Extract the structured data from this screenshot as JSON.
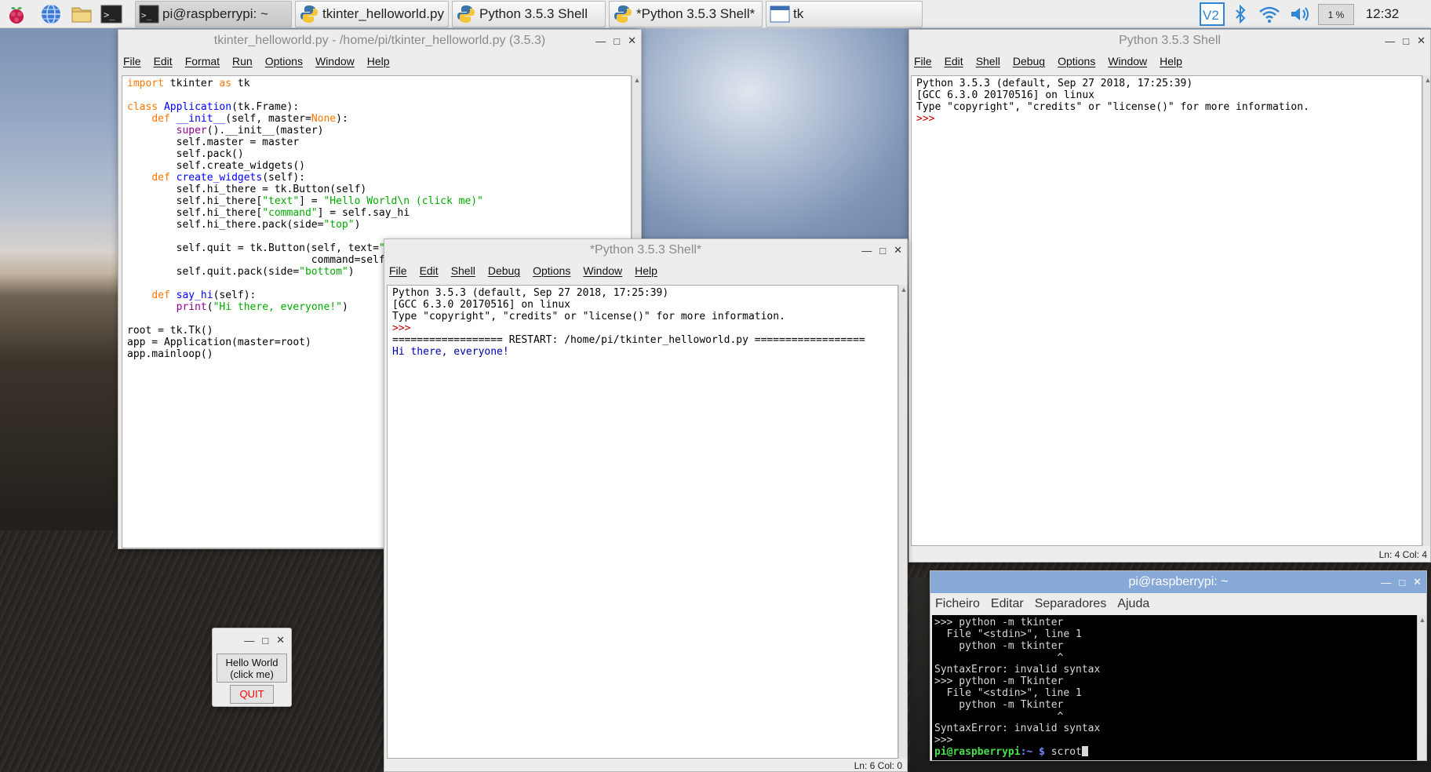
{
  "taskbar": {
    "tasks": [
      {
        "label": "pi@raspberrypi: ~"
      },
      {
        "label": "tkinter_helloworld.py ..."
      },
      {
        "label": "Python 3.5.3 Shell"
      },
      {
        "label": "*Python 3.5.3 Shell*"
      },
      {
        "label": "tk"
      }
    ],
    "cpu_label": "1 %",
    "clock": "12:32"
  },
  "editor_window": {
    "title": "tkinter_helloworld.py - /home/pi/tkinter_helloworld.py (3.5.3)",
    "menu": [
      "File",
      "Edit",
      "Format",
      "Run",
      "Options",
      "Window",
      "Help"
    ]
  },
  "shell_right": {
    "title": "Python 3.5.3 Shell",
    "menu": [
      "File",
      "Edit",
      "Shell",
      "Debug",
      "Options",
      "Window",
      "Help"
    ],
    "lines": [
      "Python 3.5.3 (default, Sep 27 2018, 17:25:39)",
      "[GCC 6.3.0 20170516] on linux",
      "Type \"copyright\", \"credits\" or \"license()\" for more information."
    ],
    "prompt": ">>>",
    "status": "Ln: 4   Col: 4"
  },
  "shell_mid": {
    "title": "*Python 3.5.3 Shell*",
    "menu": [
      "File",
      "Edit",
      "Shell",
      "Debug",
      "Options",
      "Window",
      "Help"
    ],
    "lines": [
      "Python 3.5.3 (default, Sep 27 2018, 17:25:39)",
      "[GCC 6.3.0 20170516] on linux",
      "Type \"copyright\", \"credits\" or \"license()\" for more information."
    ],
    "prompt": ">>>",
    "restart": "================== RESTART: /home/pi/tkinter_helloworld.py ==================",
    "output": "Hi there, everyone!",
    "status": "Ln: 6   Col: 0"
  },
  "terminal": {
    "title": "pi@raspberrypi: ~",
    "menu": [
      "Ficheiro",
      "Editar",
      "Separadores",
      "Ajuda"
    ],
    "lines": [
      ">>> python -m tkinter",
      "  File \"<stdin>\", line 1",
      "    python -m tkinter",
      "                    ^",
      "SyntaxError: invalid syntax",
      ">>> python -m Tkinter",
      "  File \"<stdin>\", line 1",
      "    python -m Tkinter",
      "                    ^",
      "SyntaxError: invalid syntax",
      ">>>"
    ],
    "prompt_user": "pi@raspberrypi",
    "prompt_path": ":~ $ ",
    "command": "scrot"
  },
  "tk_app": {
    "hello_button": "Hello World\n(click me)",
    "quit_button": "QUIT"
  },
  "colors": {
    "quit_text": "#ff0000",
    "focus_titlebar": "#87a9d8"
  }
}
